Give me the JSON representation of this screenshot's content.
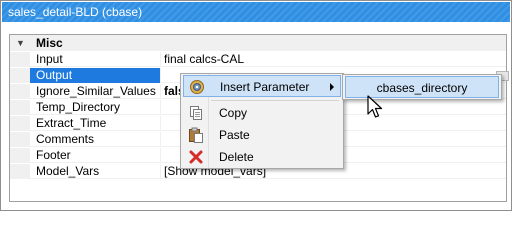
{
  "window": {
    "title": "sales_detail-BLD (cbase)"
  },
  "grid": {
    "category": {
      "toggle": "▼",
      "label": "Misc"
    },
    "rows": [
      {
        "name": "Input",
        "value": "final calcs-CAL",
        "bold": false,
        "selected": false
      },
      {
        "name": "Output",
        "value": "",
        "bold": false,
        "selected": true
      },
      {
        "name": "Ignore_Similar_Values",
        "value": "fals",
        "bold": true,
        "selected": false
      },
      {
        "name": "Temp_Directory",
        "value": "",
        "bold": false,
        "selected": false
      },
      {
        "name": "Extract_Time",
        "value": "",
        "bold": false,
        "selected": false
      },
      {
        "name": "Comments",
        "value": "",
        "bold": false,
        "selected": false
      },
      {
        "name": "Footer",
        "value": "",
        "bold": false,
        "selected": false
      },
      {
        "name": "Model_Vars",
        "value": "[Show model_vars]",
        "bold": false,
        "selected": false
      }
    ]
  },
  "context_menu": {
    "items": [
      {
        "label": "Insert Parameter",
        "icon": "gear-icon",
        "has_submenu": true,
        "highlighted": true
      },
      {
        "label": "Copy",
        "icon": "copy-icon",
        "has_submenu": false,
        "highlighted": false
      },
      {
        "label": "Paste",
        "icon": "paste-icon",
        "has_submenu": false,
        "highlighted": false
      },
      {
        "label": "Delete",
        "icon": "delete-icon",
        "has_submenu": false,
        "highlighted": false
      }
    ]
  },
  "submenu": {
    "items": [
      {
        "label": "cbases_directory",
        "highlighted": true
      }
    ]
  },
  "colors": {
    "title_bar": "#2f8fe3",
    "selection": "#1f7ae0",
    "menu_highlight": "#cfe3f8",
    "menu_highlight_border": "#7fb2e8",
    "delete_red": "#d42b2b"
  }
}
